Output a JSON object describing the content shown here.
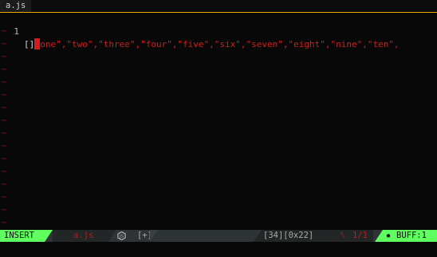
{
  "tabline": {
    "active_tab": "a.js"
  },
  "editor": {
    "lines": [
      {
        "number": "1",
        "brackets": "[]",
        "code": "one\",\"two\",\"three\",\"four\",\"five\",\"six\",\"seven\",\"eight\",\"nine\",\"ten\","
      }
    ],
    "empty_marker": "~"
  },
  "statusline": {
    "mode": "INSERT",
    "filename": "a.js",
    "language_icon": "nodejs-hexagon-icon",
    "modified": "[+]",
    "position": "[34][0x22]",
    "line_icon": "line-number-icon",
    "line_info": "1/1",
    "buffer_icon": "gear-icon",
    "buffer": "BUFF:1"
  },
  "colors": {
    "mode_bg": "#5fff5f",
    "tab_underline": "#e8a800",
    "code_text": "#cc1f1f",
    "cursor": "#d41c1c"
  }
}
